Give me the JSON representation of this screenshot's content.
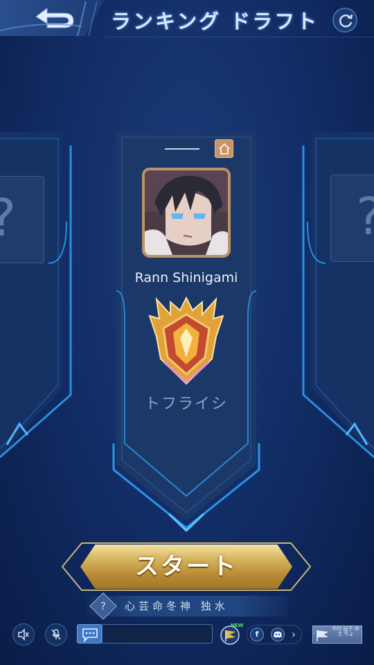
{
  "header": {
    "title": "ランキング ドラフト",
    "back_icon": "back-arrow-icon",
    "refresh_icon": "refresh-icon"
  },
  "side_slots": {
    "left_placeholder": "?",
    "right_placeholder": "?"
  },
  "player": {
    "name": "Rann Shinigami",
    "rank_name": "トフライシ",
    "home_icon": "home-icon",
    "avatar": "anime-character-avatar",
    "rank_emblem": "golden-winged-rank-emblem"
  },
  "start_button": {
    "label": "スタート"
  },
  "notice": {
    "icon_label": "?",
    "text": "心芸命冬神 独水"
  },
  "bottom_bar": {
    "speaker_icon": "speaker-muted-icon",
    "mic_icon": "microphone-muted-icon",
    "chat_icon": "chat-bubble-icon",
    "chat_input_value": "",
    "event_badge": "NEW",
    "social": {
      "facebook_label": "f",
      "discord_icon": "discord-icon",
      "more_label": "›"
    },
    "guild_text": "不行 出下 中土 ちょ"
  },
  "colors": {
    "background": "#14306a",
    "banner_fill": "#1a3566",
    "banner_border": "#2c86d2",
    "gold": "#d6b25d",
    "avatar_frame": "#b89466"
  }
}
